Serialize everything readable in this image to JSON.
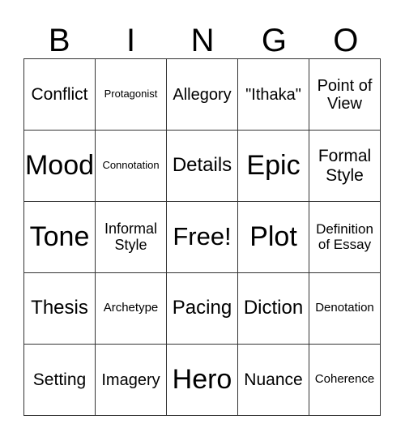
{
  "header": [
    "B",
    "I",
    "N",
    "G",
    "O"
  ],
  "rows": [
    [
      "Conflict",
      "Protagonist",
      "Allegory",
      "\"Ithaka\"",
      "Point of View"
    ],
    [
      "Mood",
      "Connotation",
      "Details",
      "Epic",
      "Formal Style"
    ],
    [
      "Tone",
      "Informal Style",
      "Free!",
      "Plot",
      "Definition of Essay"
    ],
    [
      "Thesis",
      "Archetype",
      "Pacing",
      "Diction",
      "Denotation"
    ],
    [
      "Setting",
      "Imagery",
      "Hero",
      "Nuance",
      "Coherence"
    ]
  ]
}
